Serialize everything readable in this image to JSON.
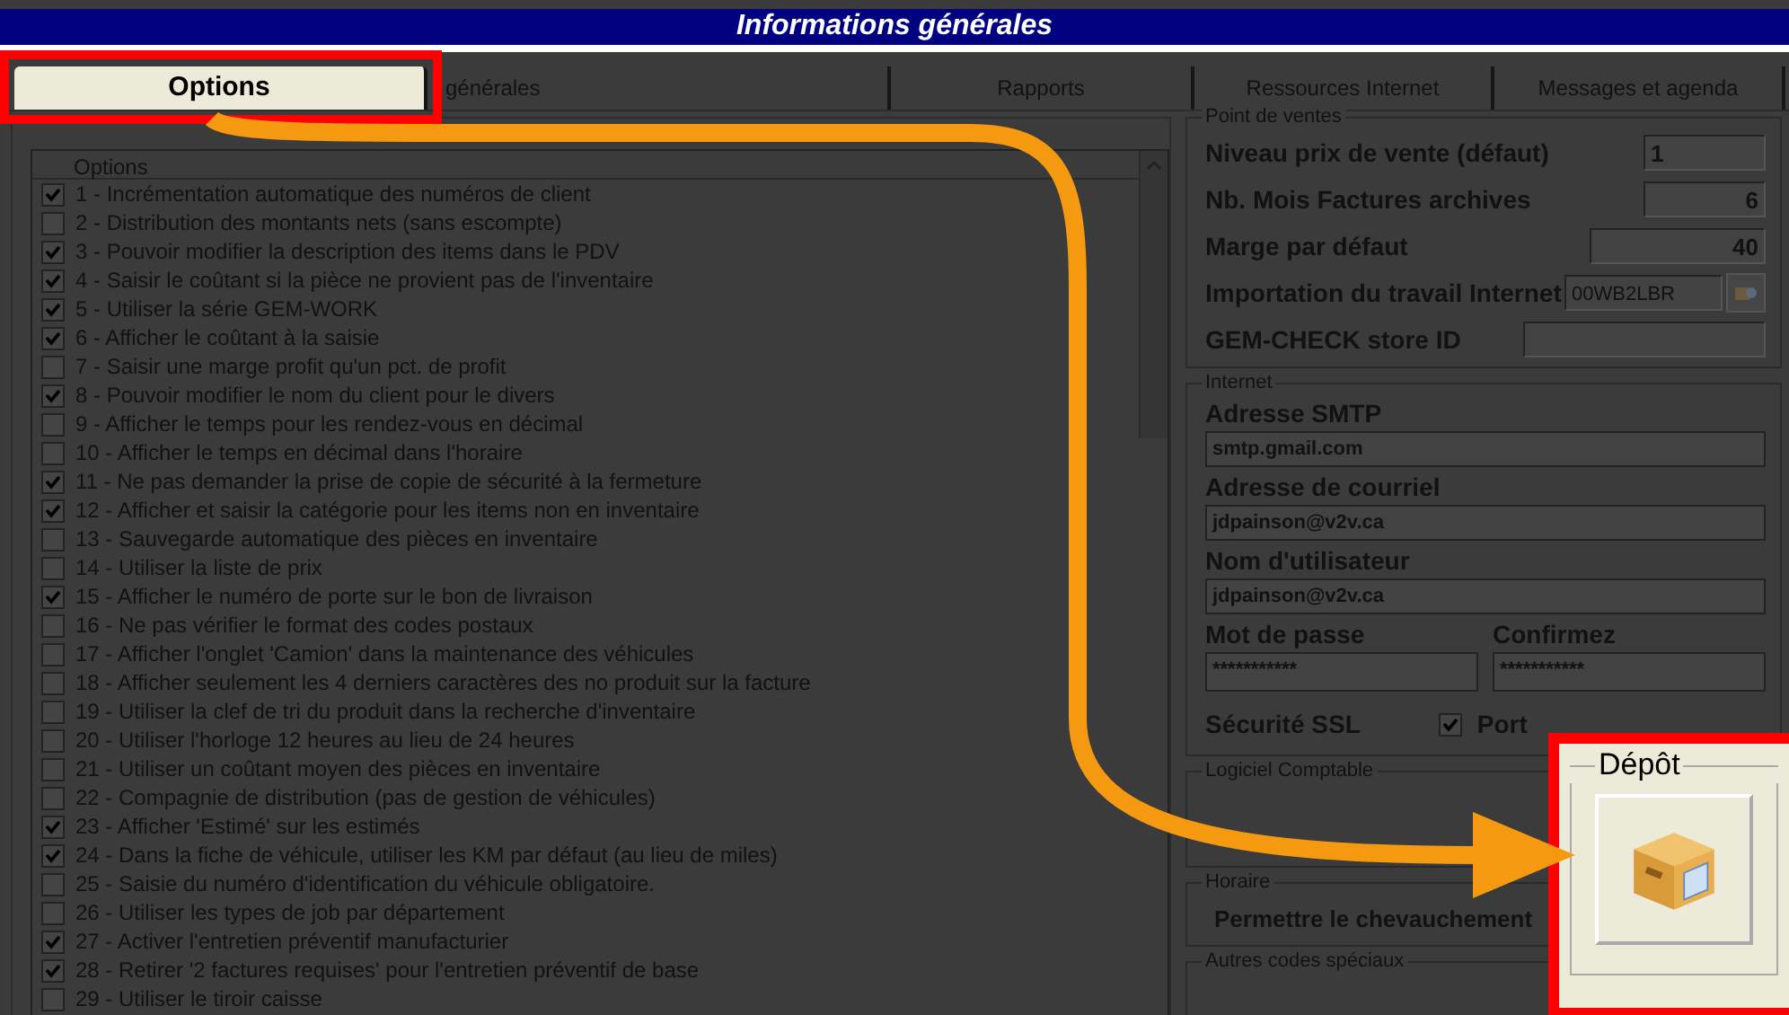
{
  "window": {
    "title": "Informations générales"
  },
  "tabs": [
    {
      "label": "Options",
      "selected": true
    },
    {
      "label": "générales",
      "selected": false
    },
    {
      "label": "Rapports",
      "selected": false
    },
    {
      "label": "Ressources Internet",
      "selected": false
    },
    {
      "label": "Messages et agenda",
      "selected": false
    }
  ],
  "options_list": {
    "header": "Options",
    "rows": [
      {
        "label": "1 - Incrémentation automatique des numéros de client",
        "checked": true
      },
      {
        "label": "2 - Distribution des montants nets (sans escompte)",
        "checked": false
      },
      {
        "label": "3 - Pouvoir modifier la description des items dans le PDV",
        "checked": true
      },
      {
        "label": "4 - Saisir le coûtant si la pièce ne provient pas de l'inventaire",
        "checked": true
      },
      {
        "label": "5 - Utiliser la série GEM-WORK",
        "checked": true
      },
      {
        "label": "6 - Afficher le coûtant à la saisie",
        "checked": true
      },
      {
        "label": "7 - Saisir une marge profit qu'un pct. de profit",
        "checked": false
      },
      {
        "label": "8 - Pouvoir modifier le nom du client pour le divers",
        "checked": true
      },
      {
        "label": "9 - Afficher le temps pour les rendez-vous en décimal",
        "checked": false
      },
      {
        "label": "10 - Afficher le temps en décimal dans l'horaire",
        "checked": false
      },
      {
        "label": "11 - Ne pas demander la prise de copie de sécurité à la fermeture",
        "checked": true
      },
      {
        "label": "12 - Afficher et saisir la catégorie pour les items non en inventaire",
        "checked": true
      },
      {
        "label": "13 - Sauvegarde automatique des pièces en inventaire",
        "checked": false
      },
      {
        "label": "14 - Utiliser la liste de prix",
        "checked": false
      },
      {
        "label": "15 - Afficher le numéro de porte sur le bon de livraison",
        "checked": true
      },
      {
        "label": "16 - Ne pas vérifier le format des codes postaux",
        "checked": false
      },
      {
        "label": "17 - Afficher l'onglet 'Camion' dans la maintenance des véhicules",
        "checked": false
      },
      {
        "label": "18 - Afficher seulement les 4 derniers caractères des no produit sur la facture",
        "checked": false
      },
      {
        "label": "19 - Utiliser la clef de tri du produit dans la recherche d'inventaire",
        "checked": false
      },
      {
        "label": "20 - Utiliser l'horloge 12 heures au lieu de 24 heures",
        "checked": false
      },
      {
        "label": "21 - Utiliser un coûtant moyen des pièces en inventaire",
        "checked": false
      },
      {
        "label": "22 - Compagnie de distribution (pas de gestion de véhicules)",
        "checked": false
      },
      {
        "label": "23 - Afficher 'Estimé' sur les estimés",
        "checked": true
      },
      {
        "label": "24 - Dans la fiche de véhicule, utiliser les KM par défaut (au lieu de miles)",
        "checked": true
      },
      {
        "label": "25 - Saisie du numéro d'identification du véhicule obligatoire.",
        "checked": false
      },
      {
        "label": "26 - Utiliser les types de job par département",
        "checked": false
      },
      {
        "label": "27 - Activer l'entretien préventif manufacturier",
        "checked": true
      },
      {
        "label": "28 - Retirer '2 factures requises' pour l'entretien préventif de base",
        "checked": true
      },
      {
        "label": "29 - Utiliser le tiroir caisse",
        "checked": false
      }
    ]
  },
  "point_de_ventes": {
    "title": "Point de ventes",
    "fields": [
      {
        "label": "Niveau prix de vente (défaut)",
        "value": "1"
      },
      {
        "label": "Nb. Mois Factures archives",
        "value": "6"
      },
      {
        "label": "Marge par défaut",
        "value": "40"
      },
      {
        "label": "Importation du travail Internet",
        "value": "00WB2LBR"
      },
      {
        "label": "GEM-CHECK store ID"
      }
    ]
  },
  "internet": {
    "title": "Internet",
    "fields": [
      {
        "label": "Adresse SMTP",
        "value": "smtp.gmail.com"
      },
      {
        "label": "Adresse de courriel",
        "value": "jdpainson@v2v.ca"
      },
      {
        "label": "Nom d'utilisateur",
        "value": "jdpainson@v2v.ca"
      }
    ],
    "password_label": "Mot de passe",
    "password_value": "***********",
    "confirm_label": "Confirmez",
    "confirm_value": "***********",
    "ssl_label": "Sécurité  SSL",
    "ssl_checked": true,
    "port_label": "Port"
  },
  "logiciel": {
    "title": "Logiciel Comptable"
  },
  "horaire": {
    "title": "Horaire",
    "label": "Permettre le chevauchement"
  },
  "autres": {
    "title": "Autres codes spéciaux"
  },
  "depot": {
    "title": "Dépôt"
  }
}
